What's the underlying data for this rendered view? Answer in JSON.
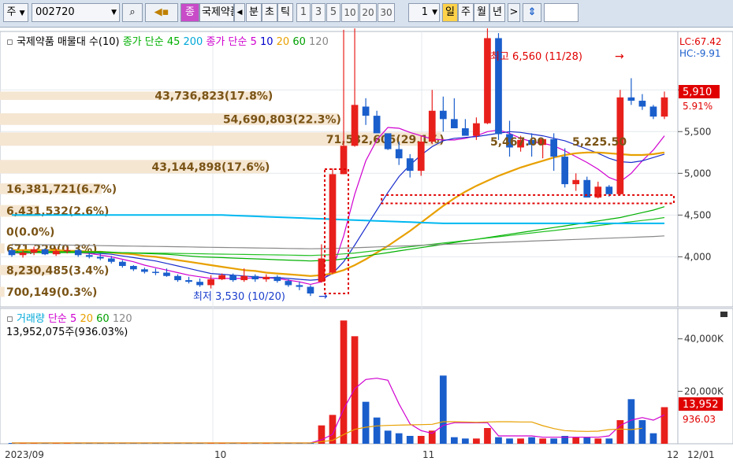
{
  "toolbar": {
    "period_type": "주",
    "symbol": "002720",
    "symbol_badge": "종",
    "stock_name": "국제약품",
    "tabs": [
      "분",
      "초",
      "틱"
    ],
    "intervals": [
      "1",
      "3",
      "5",
      "10",
      "20",
      "30"
    ],
    "count": "1",
    "periods": [
      "일",
      "주",
      "월",
      "년"
    ],
    "active_period": "일"
  },
  "price_legend": [
    {
      "text": "국제약품 매물대 수(10)",
      "color": "#000000"
    },
    {
      "text": "종가 단순 45",
      "color": "#00b000"
    },
    {
      "text": "200",
      "color": "#00a8d8"
    },
    {
      "text": "종가 단순 5",
      "color": "#d000d0"
    },
    {
      "text": "10",
      "color": "#0000cc"
    },
    {
      "text": "20",
      "color": "#e8a000"
    },
    {
      "text": "60",
      "color": "#00a000"
    },
    {
      "text": "120",
      "color": "#888888"
    }
  ],
  "volume_legend": [
    {
      "text": "거래량",
      "color": "#00a8d8"
    },
    {
      "text": "단순 5",
      "color": "#d000d0"
    },
    {
      "text": "20",
      "color": "#e8a000"
    },
    {
      "text": "60",
      "color": "#00a000"
    },
    {
      "text": "120",
      "color": "#888888"
    }
  ],
  "volume_readout": "13,952,075주(936.03%)",
  "lc_label": "LC:67.42",
  "hc_label": "HC:-9.91",
  "high_marker": "최고 6,560 (11/28)",
  "low_marker": "최저 3,530 (10/20)",
  "current_price": "5,910",
  "current_change": "5.91%",
  "current_volume": "13,952",
  "current_volume_pct": "936.03",
  "x_axis_labels": [
    "2023/09",
    "10",
    "11",
    "12",
    "12/01"
  ],
  "colors": {
    "up": "#e8201c",
    "down": "#1a5ecc",
    "band": "#f5e6d2",
    "annotation": "#7a5416",
    "box": "#e00000"
  },
  "chart_data": [
    {
      "type": "candlestick",
      "title": "국제약품 매물대 수(10)",
      "price_axis_ticks": [
        4000,
        4500,
        5000,
        5500,
        6000
      ],
      "ylim": [
        3400,
        6700
      ],
      "volume_profile": [
        {
          "price_range": [
            6200,
            6600
          ],
          "volume_label": "",
          "ratio": 0.0
        },
        {
          "price_range": [
            5880,
            5980
          ],
          "volume_label": "43,736,823(17.8%)",
          "ratio": 17.8
        },
        {
          "price_range": [
            5580,
            5720
          ],
          "volume_label": "54,690,803(22.3%)",
          "ratio": 22.3
        },
        {
          "price_range": [
            5330,
            5490
          ],
          "volume_label": "71,532,605(29.1%)",
          "ratio": 29.1
        },
        {
          "price_range": [
            5000,
            5160
          ],
          "volume_label": "43,144,898(17.6%)",
          "ratio": 17.6
        },
        {
          "price_range": [
            4750,
            4880
          ],
          "volume_label": "16,381,721(6.7%)",
          "ratio": 6.7
        },
        {
          "price_range": [
            4480,
            4620
          ],
          "volume_label": "6,431,532(2.6%)",
          "ratio": 2.6
        },
        {
          "price_range": [
            4240,
            4360
          ],
          "volume_label": "0(0.0%)",
          "ratio": 0.0
        },
        {
          "price_range": [
            4040,
            4160
          ],
          "volume_label": "671,229(0.3%)",
          "ratio": 0.3
        },
        {
          "price_range": [
            3780,
            3900
          ],
          "volume_label": "8,230,485(3.4%)",
          "ratio": 3.4
        },
        {
          "price_range": [
            3520,
            3640
          ],
          "volume_label": "700,149(0.3%)",
          "ratio": 0.3
        }
      ],
      "overlays": [
        {
          "text": "5,467.00",
          "price": 5380
        },
        {
          "text": "5,225.50",
          "price": 5380
        }
      ],
      "candles": [
        [
          4080,
          4100,
          4000,
          4020
        ],
        [
          4020,
          4080,
          3990,
          4050
        ],
        [
          4050,
          4120,
          4020,
          4090
        ],
        [
          4090,
          4100,
          4020,
          4030
        ],
        [
          4030,
          4100,
          4010,
          4070
        ],
        [
          4070,
          4110,
          4040,
          4080
        ],
        [
          4080,
          4090,
          4000,
          4020
        ],
        [
          4020,
          4050,
          3980,
          4000
        ],
        [
          4000,
          4040,
          3960,
          3980
        ],
        [
          3980,
          4010,
          3920,
          3940
        ],
        [
          3940,
          3960,
          3870,
          3890
        ],
        [
          3890,
          3900,
          3830,
          3850
        ],
        [
          3850,
          3870,
          3800,
          3820
        ],
        [
          3820,
          3860,
          3780,
          3810
        ],
        [
          3810,
          3860,
          3760,
          3770
        ],
        [
          3770,
          3790,
          3700,
          3720
        ],
        [
          3720,
          3760,
          3680,
          3700
        ],
        [
          3700,
          3740,
          3640,
          3660
        ],
        [
          3660,
          3780,
          3620,
          3730
        ],
        [
          3730,
          3800,
          3720,
          3780
        ],
        [
          3780,
          3800,
          3700,
          3720
        ],
        [
          3720,
          3860,
          3700,
          3770
        ],
        [
          3770,
          3790,
          3700,
          3730
        ],
        [
          3730,
          3790,
          3700,
          3760
        ],
        [
          3760,
          3780,
          3690,
          3710
        ],
        [
          3710,
          3730,
          3640,
          3660
        ],
        [
          3660,
          3700,
          3600,
          3640
        ],
        [
          3640,
          3660,
          3530,
          3560
        ],
        [
          3700,
          4150,
          3690,
          3980
        ],
        [
          3810,
          5060,
          3790,
          4990
        ],
        [
          4990,
          6720,
          4990,
          5330
        ],
        [
          5330,
          6920,
          5320,
          5820
        ],
        [
          5800,
          5900,
          5580,
          5690
        ],
        [
          5690,
          5750,
          5500,
          5480
        ],
        [
          5480,
          5400,
          5280,
          5290
        ],
        [
          5290,
          5380,
          5100,
          5180
        ],
        [
          5180,
          5230,
          4950,
          5030
        ],
        [
          5030,
          5450,
          4970,
          5380
        ],
        [
          5380,
          6000,
          5350,
          5750
        ],
        [
          5750,
          5920,
          5500,
          5650
        ],
        [
          5650,
          5900,
          5550,
          5540
        ],
        [
          5540,
          5650,
          5490,
          5450
        ],
        [
          5450,
          5670,
          5400,
          5600
        ],
        [
          5600,
          6950,
          5590,
          6620
        ],
        [
          6620,
          6680,
          5400,
          5470
        ],
        [
          5470,
          5630,
          5200,
          5310
        ],
        [
          5310,
          5450,
          5260,
          5400
        ],
        [
          5400,
          5480,
          5200,
          5340
        ],
        [
          5340,
          5420,
          5180,
          5410
        ],
        [
          5410,
          5480,
          5030,
          5200
        ],
        [
          5200,
          5300,
          4830,
          4870
        ],
        [
          4870,
          5000,
          4790,
          4920
        ],
        [
          4920,
          4960,
          4710,
          4710
        ],
        [
          4710,
          4900,
          4700,
          4840
        ],
        [
          4840,
          4860,
          4720,
          4750
        ],
        [
          4750,
          6000,
          4740,
          5910
        ],
        [
          5910,
          6140,
          5820,
          5870
        ],
        [
          5870,
          5950,
          5760,
          5800
        ],
        [
          5800,
          5820,
          5650,
          5680
        ],
        [
          5680,
          5980,
          5650,
          5910
        ]
      ],
      "moving_averages": {
        "5": [
          4050,
          4040,
          4050,
          4060,
          4060,
          4060,
          4050,
          4040,
          4020,
          4000,
          3970,
          3940,
          3900,
          3870,
          3840,
          3810,
          3780,
          3760,
          3740,
          3740,
          3740,
          3740,
          3750,
          3750,
          3740,
          3720,
          3700,
          3670,
          3700,
          3850,
          4250,
          4750,
          5150,
          5400,
          5550,
          5540,
          5490,
          5450,
          5410,
          5400,
          5400,
          5420,
          5450,
          5500,
          5520,
          5480,
          5420,
          5380,
          5360,
          5330,
          5270,
          5200,
          5130,
          5050,
          4950,
          4900,
          5000,
          5150,
          5280,
          5450
        ],
        "10": [
          4060,
          4060,
          4060,
          4060,
          4060,
          4060,
          4060,
          4050,
          4040,
          4030,
          4010,
          3990,
          3970,
          3950,
          3920,
          3890,
          3860,
          3830,
          3800,
          3790,
          3780,
          3770,
          3760,
          3750,
          3750,
          3740,
          3730,
          3720,
          3730,
          3800,
          3940,
          4140,
          4350,
          4560,
          4770,
          4960,
          5100,
          5220,
          5320,
          5390,
          5420,
          5430,
          5440,
          5460,
          5480,
          5500,
          5490,
          5470,
          5450,
          5420,
          5390,
          5340,
          5290,
          5240,
          5180,
          5140,
          5130,
          5150,
          5190,
          5230
        ],
        "20": [
          4080,
          4080,
          4080,
          4080,
          4080,
          4070,
          4070,
          4060,
          4060,
          4050,
          4040,
          4030,
          4010,
          4000,
          3980,
          3960,
          3940,
          3920,
          3900,
          3880,
          3860,
          3840,
          3830,
          3810,
          3800,
          3790,
          3780,
          3770,
          3780,
          3800,
          3840,
          3900,
          3970,
          4050,
          4130,
          4220,
          4310,
          4410,
          4510,
          4610,
          4700,
          4780,
          4850,
          4910,
          4970,
          5020,
          5070,
          5110,
          5150,
          5190,
          5220,
          5240,
          5250,
          5250,
          5240,
          5230,
          5220,
          5220,
          5230,
          5250
        ],
        "45": [
          4060,
          4060,
          4060,
          4060,
          4060,
          4060,
          4060,
          4060,
          4060,
          4055,
          4050,
          4045,
          4040,
          4035,
          4030,
          4020,
          4010,
          4000,
          3995,
          3990,
          3985,
          3980,
          3975,
          3970,
          3965,
          3960,
          3955,
          3950,
          3955,
          3960,
          3975,
          3990,
          4010,
          4030,
          4050,
          4070,
          4090,
          4110,
          4130,
          4150,
          4170,
          4190,
          4210,
          4230,
          4250,
          4270,
          4290,
          4310,
          4330,
          4350,
          4370,
          4390,
          4410,
          4430,
          4450,
          4470,
          4500,
          4530,
          4560,
          4600
        ],
        "60": [
          4050,
          4050,
          4050,
          4050,
          4050,
          4050,
          4050,
          4050,
          4050,
          4050,
          4050,
          4048,
          4046,
          4044,
          4042,
          4040,
          4038,
          4036,
          4034,
          4032,
          4030,
          4028,
          4026,
          4024,
          4022,
          4020,
          4018,
          4016,
          4020,
          4025,
          4035,
          4045,
          4060,
          4075,
          4090,
          4105,
          4120,
          4135,
          4150,
          4165,
          4180,
          4195,
          4210,
          4225,
          4240,
          4255,
          4270,
          4285,
          4300,
          4315,
          4330,
          4345,
          4360,
          4375,
          4390,
          4405,
          4420,
          4435,
          4450,
          4470
        ],
        "120": [
          4150,
          4148,
          4146,
          4144,
          4142,
          4140,
          4138,
          4136,
          4134,
          4132,
          4130,
          4128,
          4126,
          4124,
          4122,
          4120,
          4118,
          4116,
          4114,
          4112,
          4110,
          4108,
          4106,
          4104,
          4102,
          4100,
          4098,
          4096,
          4098,
          4100,
          4104,
          4108,
          4113,
          4118,
          4123,
          4128,
          4133,
          4138,
          4143,
          4148,
          4153,
          4158,
          4163,
          4168,
          4173,
          4178,
          4183,
          4188,
          4193,
          4198,
          4203,
          4208,
          4213,
          4218,
          4223,
          4228,
          4233,
          4238,
          4243,
          4250
        ],
        "200": [
          4500,
          4500,
          4500,
          4500,
          4500,
          4500,
          4500,
          4500,
          4500,
          4500,
          4500,
          4500,
          4500,
          4500,
          4500,
          4500,
          4500,
          4500,
          4500,
          4500,
          4495,
          4490,
          4485,
          4480,
          4475,
          4470,
          4465,
          4460,
          4455,
          4450,
          4445,
          4440,
          4435,
          4430,
          4425,
          4420,
          4415,
          4410,
          4405,
          4400,
          4400,
          4400,
          4400,
          4400,
          4400,
          4400,
          4400,
          4400,
          4400,
          4400,
          4400,
          4400,
          4400,
          4400,
          4400,
          4400,
          4400,
          4400,
          4400,
          4400
        ]
      }
    },
    {
      "type": "bar",
      "title": "거래량",
      "ylabel": "주",
      "y_axis_ticks": [
        20000,
        40000
      ],
      "ylim": [
        0,
        48000
      ],
      "volume_unit": "천주",
      "values": [
        300,
        300,
        300,
        300,
        300,
        300,
        300,
        300,
        300,
        300,
        300,
        300,
        300,
        300,
        300,
        300,
        300,
        300,
        300,
        300,
        300,
        300,
        300,
        300,
        300,
        300,
        300,
        300,
        7000,
        11000,
        47000,
        41000,
        16000,
        10000,
        5000,
        4000,
        3000,
        3000,
        5000,
        26000,
        2500,
        2000,
        2000,
        6000,
        2500,
        2000,
        2000,
        2500,
        2000,
        2000,
        3000,
        2500,
        2500,
        2000,
        2000,
        9000,
        17000,
        9000,
        4000,
        13952
      ],
      "ma5": [
        300,
        300,
        300,
        300,
        300,
        300,
        300,
        300,
        300,
        300,
        300,
        300,
        300,
        300,
        300,
        300,
        300,
        300,
        300,
        300,
        300,
        300,
        300,
        300,
        300,
        300,
        300,
        300,
        1500,
        3600,
        13200,
        21000,
        24500,
        25000,
        24200,
        15200,
        7600,
        5000,
        4000,
        7000,
        8000,
        8000,
        8000,
        8000,
        3000,
        3000,
        3000,
        3000,
        2500,
        2500,
        2500,
        2500,
        2500,
        2500,
        3000,
        7000,
        9000,
        10000,
        9000,
        11000
      ],
      "ma20": [
        300,
        300,
        300,
        300,
        300,
        300,
        300,
        300,
        300,
        300,
        300,
        300,
        300,
        300,
        300,
        300,
        300,
        300,
        300,
        300,
        300,
        300,
        300,
        300,
        300,
        300,
        300,
        300,
        800,
        1300,
        3500,
        5500,
        6300,
        6800,
        7000,
        7100,
        7200,
        7300,
        7400,
        8400,
        8400,
        8300,
        8200,
        8300,
        8400,
        8400,
        8300,
        8300,
        6900,
        5800,
        5000,
        4800,
        4700,
        4800,
        5400,
        5600,
        5400,
        5900
      ]
    }
  ]
}
